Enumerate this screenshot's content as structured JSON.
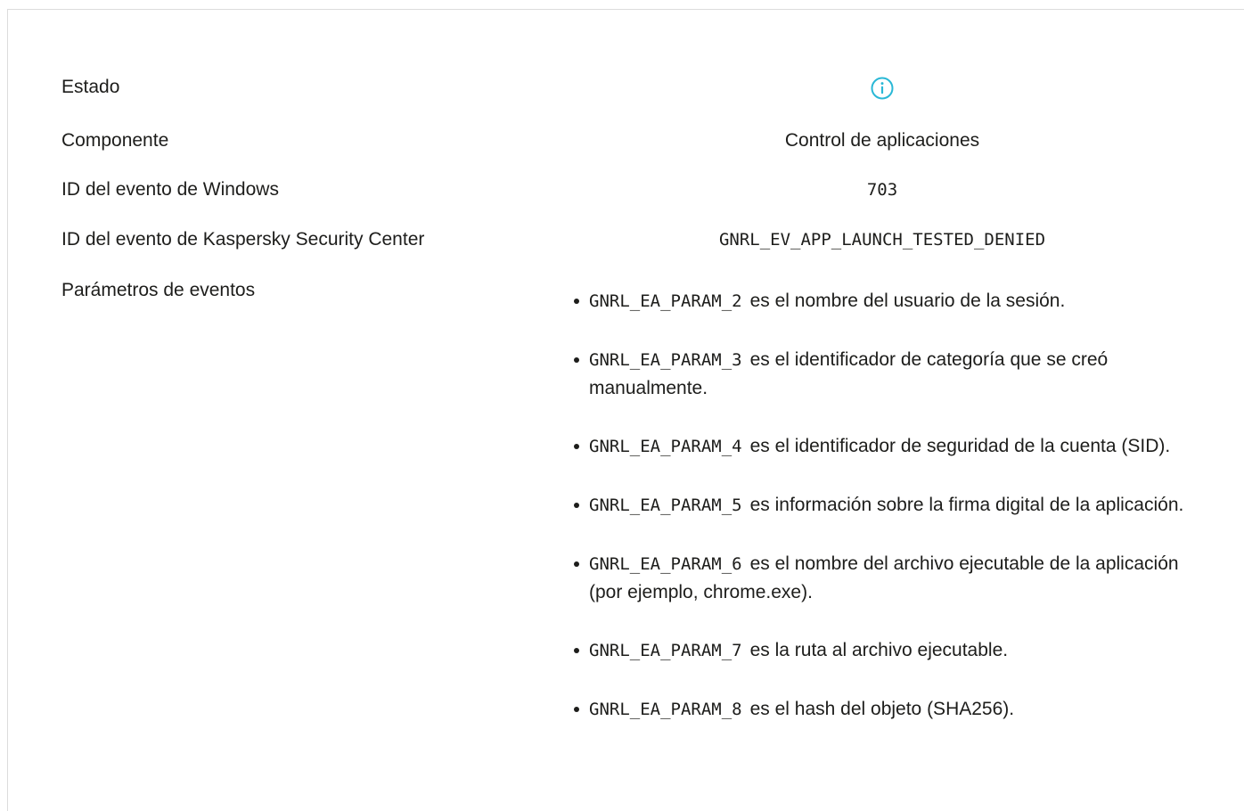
{
  "rows": {
    "status": {
      "label": "Estado",
      "icon": "info-circle-icon",
      "icon_color": "#2ab8d6"
    },
    "component": {
      "label": "Componente",
      "value": "Control de aplicaciones"
    },
    "windows_event_id": {
      "label": "ID del evento de Windows",
      "value": "703"
    },
    "ksc_event_id": {
      "label": "ID del evento de Kaspersky Security Center",
      "value": "GNRL_EV_APP_LAUNCH_TESTED_DENIED"
    },
    "event_params": {
      "label": "Parámetros de eventos",
      "items": [
        {
          "code": "GNRL_EA_PARAM_2",
          "text": "es el nombre del usuario de la sesión."
        },
        {
          "code": "GNRL_EA_PARAM_3",
          "text": "es el identificador de categoría que se creó manualmente."
        },
        {
          "code": "GNRL_EA_PARAM_4",
          "text": "es el identificador de seguridad de la cuenta (SID)."
        },
        {
          "code": "GNRL_EA_PARAM_5",
          "text": "es información sobre la firma digital de la aplicación."
        },
        {
          "code": "GNRL_EA_PARAM_6",
          "text": "es el nombre del archivo ejecutable de la aplicación (por ejemplo, chrome.exe)."
        },
        {
          "code": "GNRL_EA_PARAM_7",
          "text": "es la ruta al archivo ejecutable."
        },
        {
          "code": "GNRL_EA_PARAM_8",
          "text": "es el hash del objeto (SHA256)."
        }
      ]
    }
  }
}
